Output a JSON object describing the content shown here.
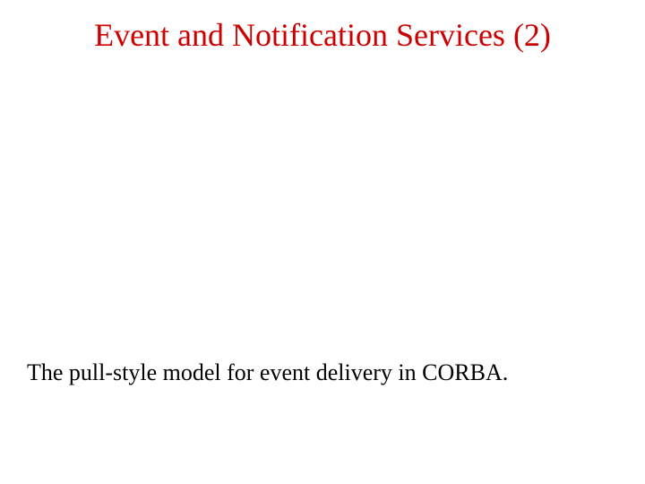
{
  "colors": {
    "title": "#cc0000",
    "body": "#000000"
  },
  "slide": {
    "title": "Event and Notification Services (2)",
    "body": "The pull-style model for event delivery in CORBA."
  }
}
